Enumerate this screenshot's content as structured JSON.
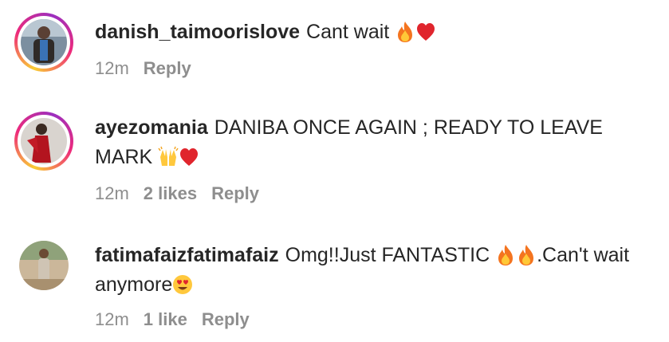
{
  "comments": [
    {
      "username": "danish_taimoorislove",
      "text": "Cant wait",
      "emoji_after": [
        "fire-emoji",
        "red-heart-emoji"
      ],
      "time": "12m",
      "likes": "",
      "reply_label": "Reply",
      "story_ring": true
    },
    {
      "username": "ayezomania",
      "text": "DANIBA ONCE AGAIN ; READY TO LEAVE MARK",
      "emoji_after": [
        "raising-hands-emoji",
        "red-heart-emoji"
      ],
      "time": "12m",
      "likes": "2 likes",
      "reply_label": "Reply",
      "story_ring": true
    },
    {
      "username": "fatimafaizfatimafaiz",
      "text_before": "Omg!!Just FANTASTIC",
      "text_middle": ".Can't wait anymore",
      "emoji_mid": [
        "fire-emoji",
        "fire-emoji"
      ],
      "emoji_after": [
        "heart-eyes-emoji"
      ],
      "time": "12m",
      "likes": "1 like",
      "reply_label": "Reply",
      "story_ring": false
    }
  ],
  "colors": {
    "text": "#262626",
    "meta": "#8e8e8e",
    "ring_start": "#f9ce34",
    "ring_mid": "#ee2a7b",
    "ring_end": "#9b2fbf"
  }
}
